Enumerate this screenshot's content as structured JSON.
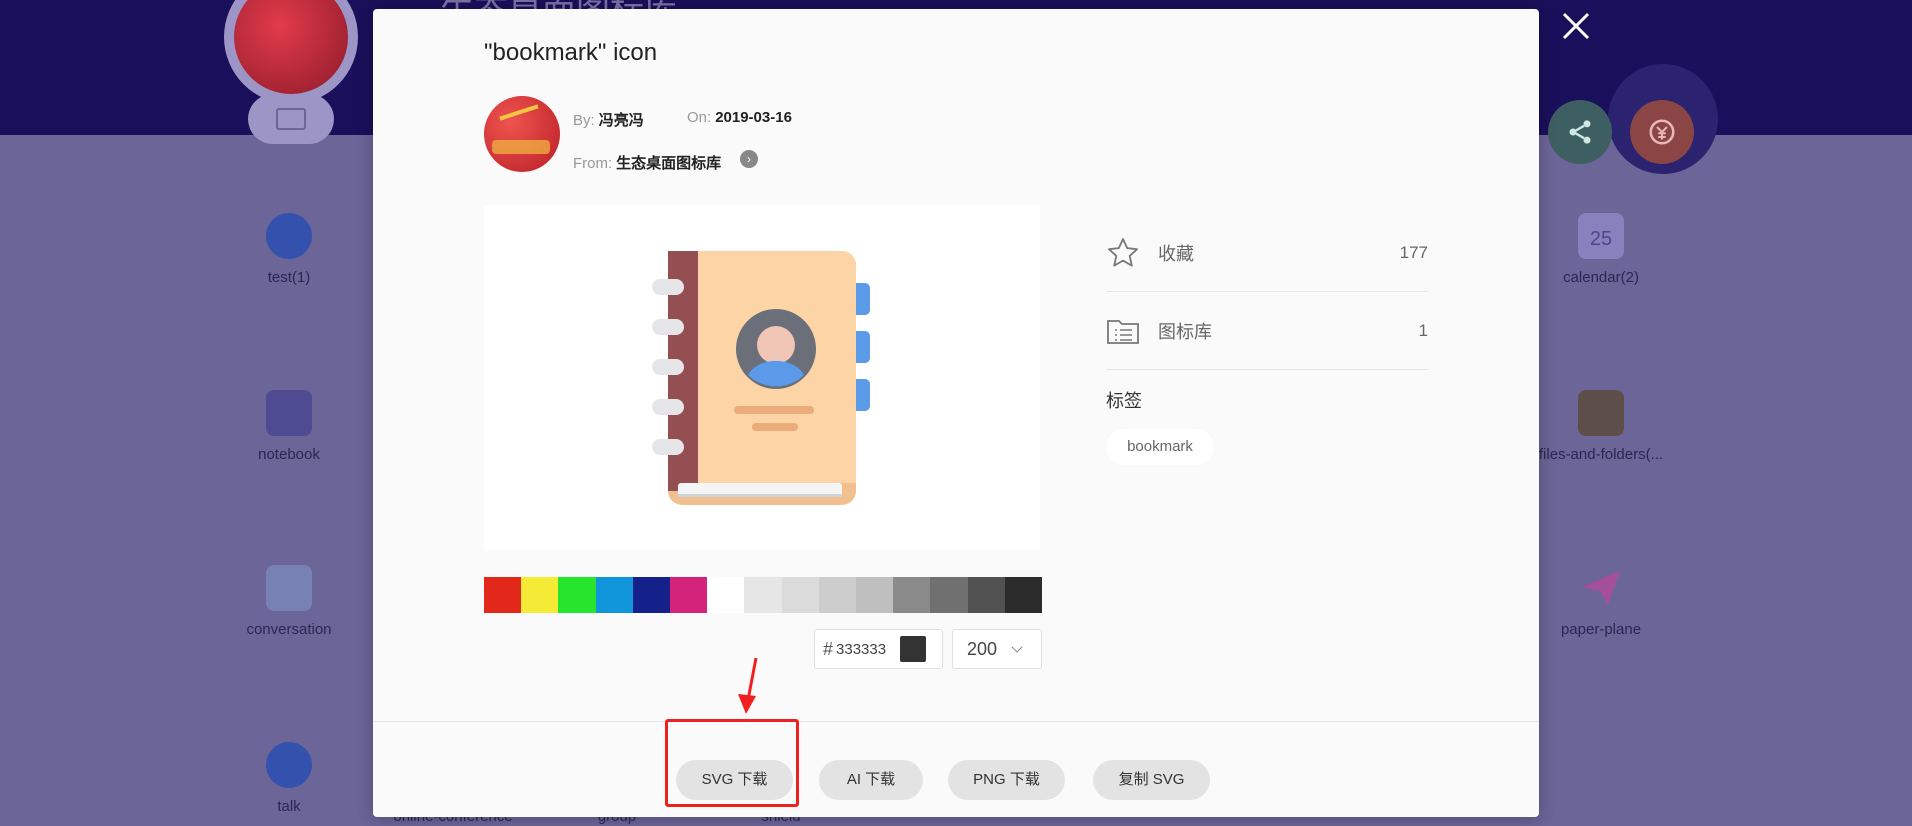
{
  "background": {
    "header_title": "生态桌面图标库",
    "items": [
      {
        "label": "test(1)"
      },
      {
        "label": "notebook"
      },
      {
        "label": "conversation"
      },
      {
        "label": "talk"
      },
      {
        "label": "online-conference"
      },
      {
        "label": "group"
      },
      {
        "label": "shield"
      },
      {
        "label": "calendar(2)"
      },
      {
        "label": "files-and-folders(..."
      },
      {
        "label": "paper-plane"
      }
    ],
    "calendar_day": "25"
  },
  "modal": {
    "title": "\"bookmark\" icon",
    "meta": {
      "by_label": "By:",
      "by_value": "冯亮冯",
      "on_label": "On:",
      "on_value": "2019-03-16",
      "from_label": "From:",
      "from_value": "生态桌面图标库"
    },
    "palette": [
      "#e2281a",
      "#f5ea35",
      "#27e52c",
      "#1296db",
      "#14218a",
      "#d4237a",
      "#ffffff",
      "#e6e6e6",
      "#dbdbdb",
      "#cdcdcd",
      "#bfbfbf",
      "#8a8a8a",
      "#707070",
      "#515151",
      "#2c2c2c"
    ],
    "color_input": {
      "hash": "#",
      "value": "333333"
    },
    "size_select": {
      "value": "200"
    },
    "stats": {
      "favorite_label": "收藏",
      "favorite_count": "177",
      "library_label": "图标库",
      "library_count": "1"
    },
    "tags_title": "标签",
    "tags": [
      "bookmark"
    ],
    "buttons": {
      "svg": "SVG 下载",
      "ai": "AI 下载",
      "png": "PNG 下载",
      "copy_svg": "复制 SVG"
    }
  },
  "colors": {
    "annotation": "#f02020",
    "selected_color": "#333333"
  }
}
